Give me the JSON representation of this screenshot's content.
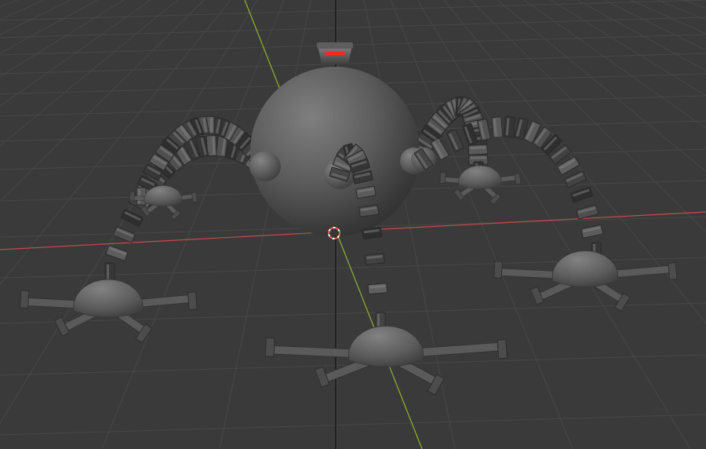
{
  "viewport": {
    "background_color": "#3a3a3a",
    "grid_line_color": "#474747",
    "x_axis_color": "#c84a4a",
    "y_axis_color": "#8fb52e",
    "z_axis_color": "#111111",
    "cursor_colors": [
      "#ff5a4a",
      "#ffffff"
    ]
  },
  "scene": {
    "object": "spider-robot",
    "body_color": "#5a5a5a",
    "eye_light_color": "#ff2424",
    "leg_count": 5,
    "segment_counts": [
      18,
      22,
      14,
      18,
      20
    ]
  }
}
